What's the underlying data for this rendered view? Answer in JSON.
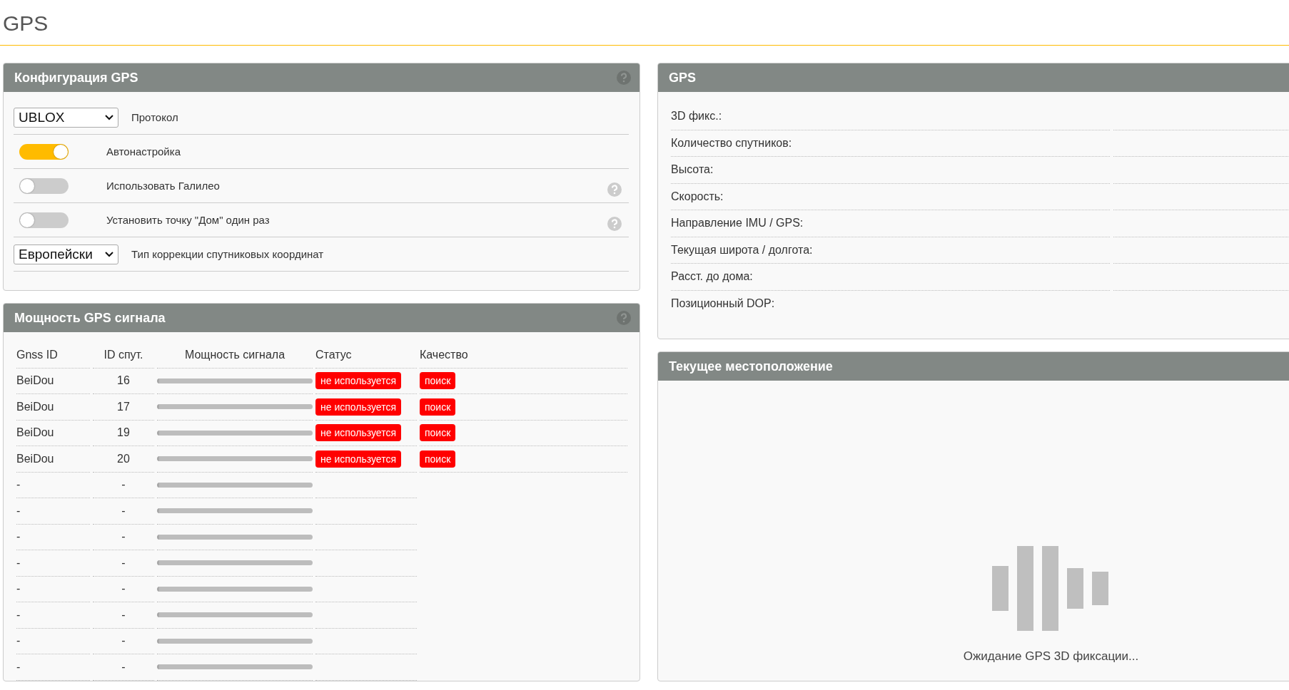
{
  "page_title": "GPS",
  "config": {
    "title": "Конфигурация GPS",
    "items": [
      {
        "kind": "select",
        "value": "UBLOX",
        "label": "Протокол",
        "help": false
      },
      {
        "kind": "toggle",
        "on": true,
        "label": "Автонастройка",
        "help": false
      },
      {
        "kind": "toggle",
        "on": false,
        "label": "Использовать Галилео",
        "help": true
      },
      {
        "kind": "toggle",
        "on": false,
        "label": "Установить точку \"Дом\" один раз",
        "help": true
      },
      {
        "kind": "select",
        "value": "Европейски",
        "label": "Тип коррекции спутниковых координат",
        "help": false
      }
    ]
  },
  "signal": {
    "title": "Мощность GPS сигнала",
    "columns": [
      "Gnss ID",
      "ID спут.",
      "Мощность сигнала",
      "Статус",
      "Качество"
    ],
    "rows": [
      {
        "gnss": "BeiDou",
        "sat_id": "16",
        "level": 0,
        "status": "не используется",
        "quality": "поиск"
      },
      {
        "gnss": "BeiDou",
        "sat_id": "17",
        "level": 0,
        "status": "не используется",
        "quality": "поиск"
      },
      {
        "gnss": "BeiDou",
        "sat_id": "19",
        "level": 0,
        "status": "не используется",
        "quality": "поиск"
      },
      {
        "gnss": "BeiDou",
        "sat_id": "20",
        "level": 0,
        "status": "не используется",
        "quality": "поиск"
      },
      {
        "gnss": "-",
        "sat_id": "-",
        "level": 0
      },
      {
        "gnss": "-",
        "sat_id": "-",
        "level": 0
      },
      {
        "gnss": "-",
        "sat_id": "-",
        "level": 0
      },
      {
        "gnss": "-",
        "sat_id": "-",
        "level": 0
      },
      {
        "gnss": "-",
        "sat_id": "-",
        "level": 0
      },
      {
        "gnss": "-",
        "sat_id": "-",
        "level": 0
      },
      {
        "gnss": "-",
        "sat_id": "-",
        "level": 0
      },
      {
        "gnss": "-",
        "sat_id": "-",
        "level": 0
      }
    ]
  },
  "gps": {
    "title": "GPS",
    "rows": [
      "3D фикс.:",
      "Количество спутников:",
      "Высота:",
      "Скорость:",
      "Направление IMU / GPS:",
      "Текущая широта / долгота:",
      "Расст. до дома:",
      "Позиционный DOP:"
    ]
  },
  "location": {
    "title": "Текущее местоположение",
    "message": "Ожидание GPS 3D фиксации..."
  }
}
